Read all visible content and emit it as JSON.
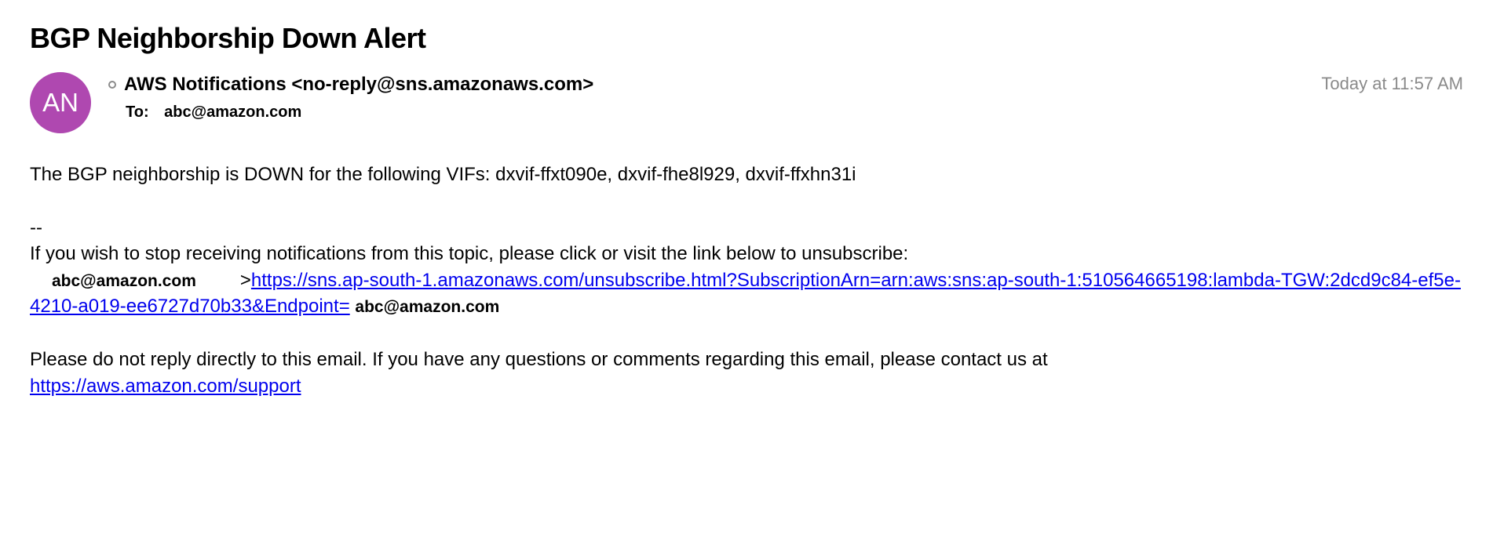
{
  "subject": "BGP Neighborship Down Alert",
  "avatar_initials": "AN",
  "from": "AWS Notifications <no-reply@sns.amazonaws.com>",
  "to_label": "To:",
  "to_value": "abc@amazon.com",
  "timestamp": "Today at 11:57 AM",
  "body": {
    "line1": "The BGP neighborship is DOWN for the following VIFs: dxvif-ffxt090e, dxvif-fhe8l929, dxvif-ffxhn31i",
    "sep": "--",
    "unsub_intro": "If you wish to stop receiving notifications from this topic, please click or visit the link below to unsubscribe:",
    "unsub_prefix_email": "abc@amazon.com",
    "unsub_angle": ">",
    "unsub_link": "https://sns.ap-south-1.amazonaws.com/unsubscribe.html?SubscriptionArn=arn:aws:sns:ap-south-1:510564665198:lambda-TGW:2dcd9c84-ef5e-4210-a019-ee6727d70b33&Endpoint=",
    "unsub_suffix_email": "abc@amazon.com",
    "noreply_text": "Please do not reply directly to this email. If you have any questions or comments regarding this email, please contact us at ",
    "support_link": "https://aws.amazon.com/support"
  }
}
